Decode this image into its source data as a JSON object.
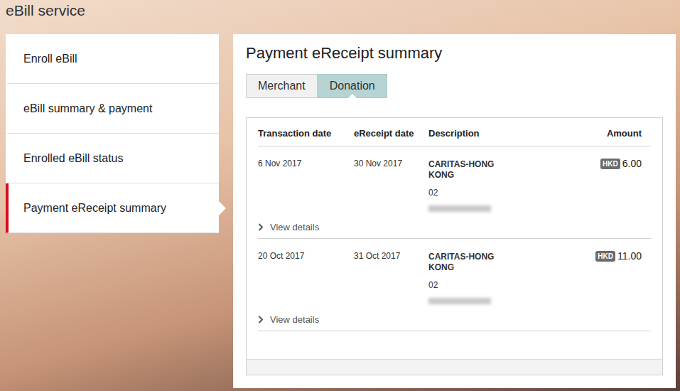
{
  "page": {
    "title": "eBill service"
  },
  "sidebar": {
    "items": [
      {
        "label": "Enroll eBill",
        "selected": false
      },
      {
        "label": "eBill summary & payment",
        "selected": false
      },
      {
        "label": "Enrolled eBill status",
        "selected": false
      },
      {
        "label": "Payment eReceipt summary",
        "selected": true
      }
    ]
  },
  "panel": {
    "title": "Payment eReceipt summary",
    "tabs": [
      {
        "label": "Merchant",
        "selected": false
      },
      {
        "label": "Donation",
        "selected": true
      }
    ]
  },
  "table": {
    "columns": [
      "Transaction date",
      "eReceipt date",
      "Description",
      "Amount"
    ],
    "rows": [
      {
        "transaction_date": "6 Nov 2017",
        "ereceipt_date": "30 Nov 2017",
        "merchant": "CARITAS-HONG KONG",
        "code": "02",
        "currency": "HKD",
        "amount": "6.00",
        "details_label": "View details",
        "expanded": false
      },
      {
        "transaction_date": "20 Oct 2017",
        "ereceipt_date": "31 Oct 2017",
        "merchant": "CARITAS-HONG KONG",
        "code": "02",
        "currency": "HKD",
        "amount": "11.00",
        "details_label": "View details",
        "expanded": false
      }
    ]
  }
}
